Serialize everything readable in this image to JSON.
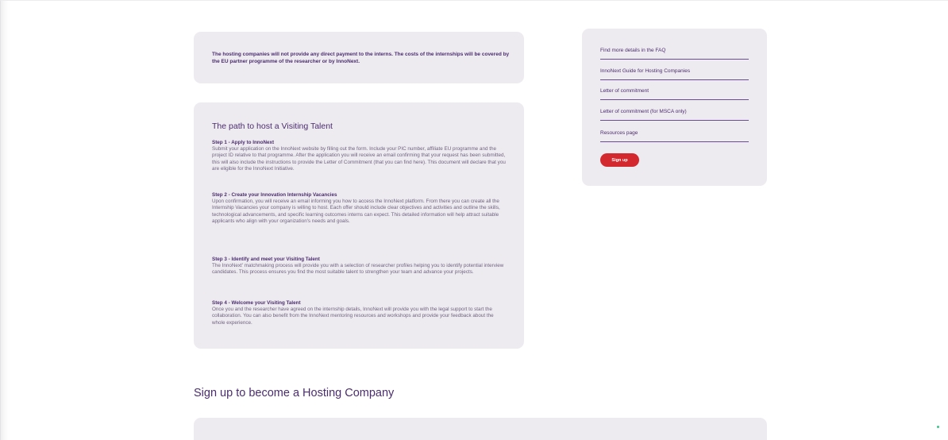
{
  "info": {
    "text": "The hosting companies will not provide any direct payment to the interns. The costs of the internships will be covered by the EU partner programme of the researcher or by InnoNext."
  },
  "path": {
    "title": "The path to host a Visiting Talent",
    "steps": [
      {
        "title": "Step 1 - Apply to InnoNext",
        "body": "Submit your application on the InnoNext website by filling out the form. Include your PIC number, affiliate EU programme and the project ID relative to that programme. After the application you will receive an email confirming that your request has been submitted, this will also include the instructions to provide the Letter of Commitment (that you can find here). This document will declare that you are eligible for the InnoNext Initiative."
      },
      {
        "title": "Step 2 - Create your Innovation Internship Vacancies",
        "body": "Upon confirmation, you will receive an email informing you how to access the InnoNext platform. From there you can create all the Internship Vacancies your company is willing to host. Each offer should include clear objectives and activities and outline the skills, technological advancements, and specific learning outcomes interns can expect. This detailed information will help attract suitable applicants who align with your organization's needs and goals."
      },
      {
        "title": "Step 3 - Identify and meet your Visiting Talent",
        "body": "The InnoNext' matchmaking process will provide you with a selection of researcher profiles helping you to identify potential interview candidates. This process ensures you find the most suitable talent to strengthen your team and advance your projects."
      },
      {
        "title": "Step 4 - Welcome your Visiting Talent",
        "body": "Once you and the researcher have agreed on the internship details, InnoNext will provide you with the legal support to start the collaboration. You can also benefit from the InnoNext mentoring resources and workshops and provide your feedback about the whole experience."
      }
    ]
  },
  "sidebar": {
    "links": [
      "Find more details in the FAQ",
      "InnoNext Guide for Hosting Companies",
      "Letter of commitment",
      "Letter of commitment (for MSCA only)",
      "Resources page"
    ],
    "signup_label": "Sign up"
  },
  "section": {
    "heading": "Sign up to become a Hosting Company"
  },
  "colors": {
    "card_bg": "#eeebf0",
    "heading_purple": "#4a2d6e",
    "button_red": "#d4282f"
  }
}
